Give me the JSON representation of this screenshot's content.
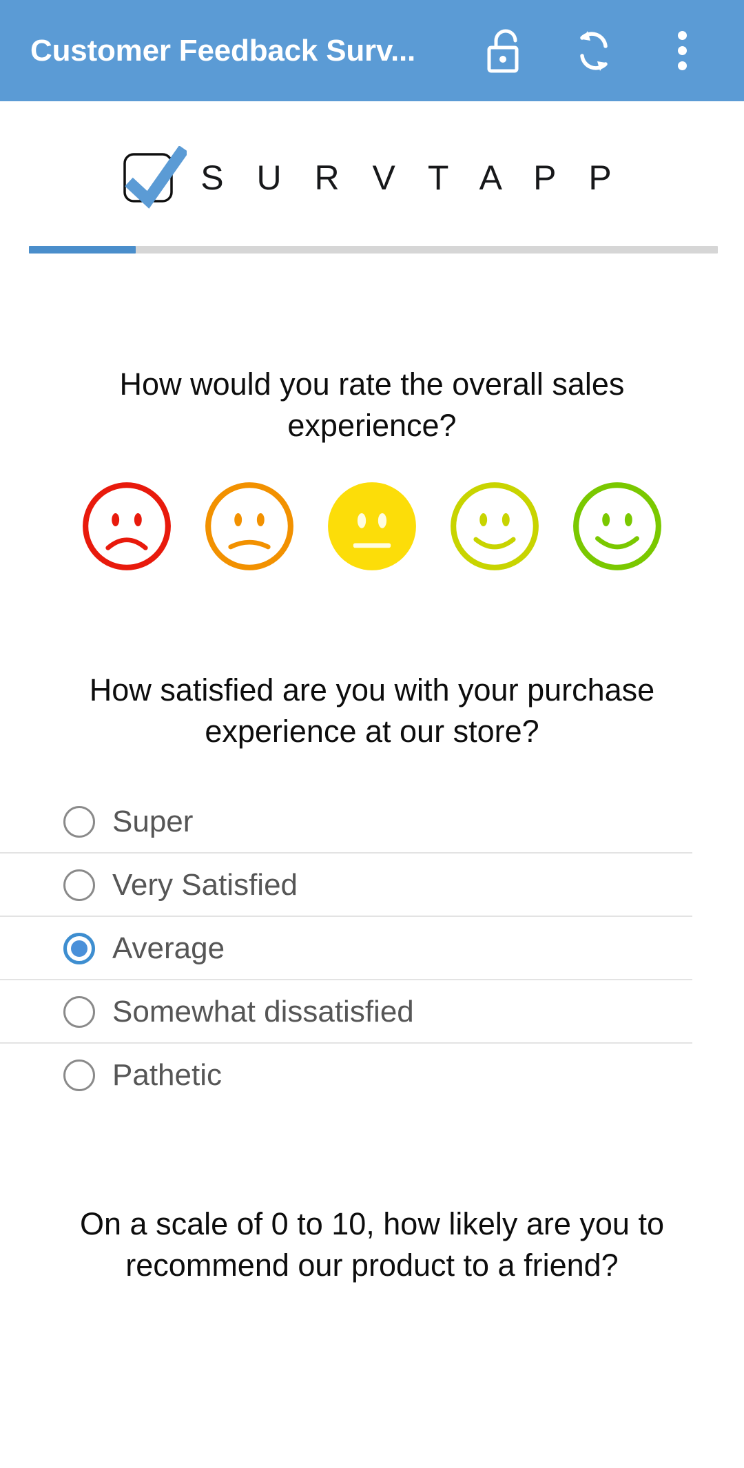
{
  "appbar": {
    "title": "Customer Feedback Surv...",
    "background_color": "#5b9bd5",
    "actions": [
      {
        "name": "unlock-icon",
        "label": "Unlock"
      },
      {
        "name": "sync-icon",
        "label": "Sync"
      },
      {
        "name": "overflow-menu-icon",
        "label": "More options"
      }
    ]
  },
  "logo": {
    "text": "S U R V T A P P",
    "mark": "checkbox-check-icon",
    "check_color": "#5b9bd5"
  },
  "progress": {
    "percent": 15.5,
    "fill_color": "#4a8ecb",
    "track_color": "#d6d6d6"
  },
  "questions": [
    {
      "id": "q1",
      "text": "How would you rate the overall sales experience?",
      "type": "smiley-scale",
      "selected_index": 2,
      "options": [
        {
          "name": "smiley-very-sad",
          "mood": "sad",
          "color": "#e81a0c",
          "filled": false
        },
        {
          "name": "smiley-sad",
          "mood": "sad",
          "color": "#f29100",
          "filled": false
        },
        {
          "name": "smiley-neutral",
          "mood": "neutral",
          "color": "#fcdd09",
          "filled": true
        },
        {
          "name": "smiley-happy",
          "mood": "happy",
          "color": "#c8d400",
          "filled": false
        },
        {
          "name": "smiley-very-happy",
          "mood": "happy",
          "color": "#7ac800",
          "filled": false
        }
      ]
    },
    {
      "id": "q2",
      "text": "How satisfied are you with your purchase experience at our store?",
      "type": "radio",
      "selected_index": 2,
      "options": [
        {
          "label": "Super"
        },
        {
          "label": "Very Satisfied"
        },
        {
          "label": "Average"
        },
        {
          "label": "Somewhat dissatisfied"
        },
        {
          "label": "Pathetic"
        }
      ]
    },
    {
      "id": "q3",
      "text": "On a scale of 0 to 10, how likely are you to recommend our product to a friend?",
      "type": "rating-scale"
    }
  ]
}
